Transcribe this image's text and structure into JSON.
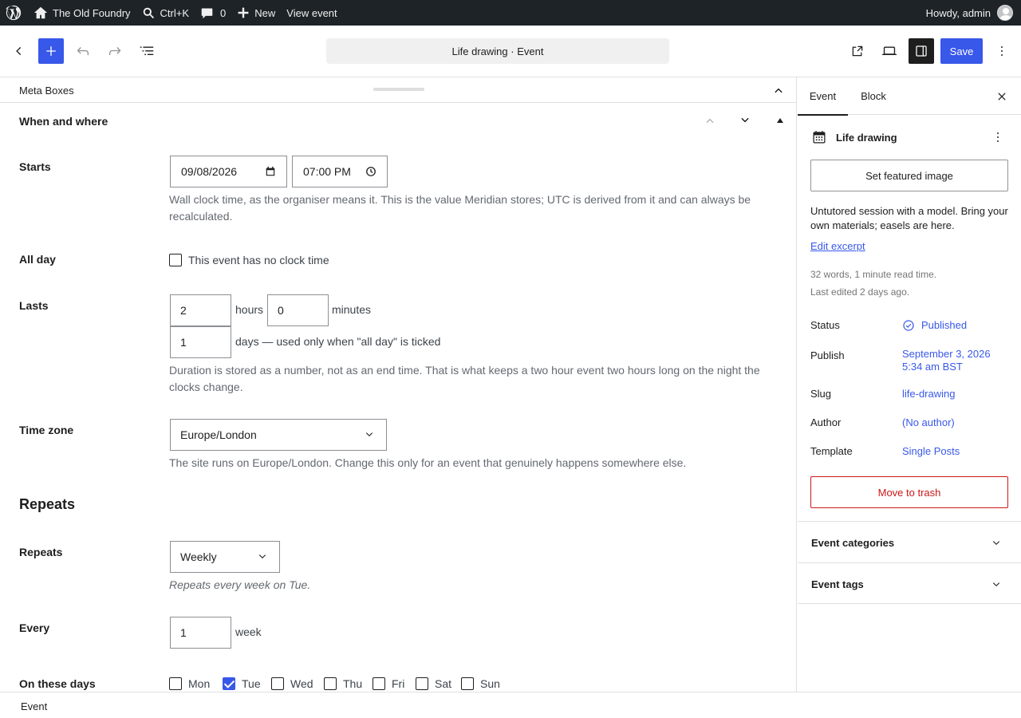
{
  "admin_bar": {
    "site_name": "The Old Foundry",
    "search_shortcut": "Ctrl+K",
    "comments_count": "0",
    "new_label": "New",
    "view_label": "View event",
    "howdy": "Howdy, admin"
  },
  "header": {
    "document_title": "Life drawing · Event",
    "save_label": "Save"
  },
  "meta_boxes": {
    "title": "Meta Boxes",
    "panel_title": "When and where"
  },
  "form": {
    "starts": {
      "label": "Starts",
      "date": "09/08/2026",
      "time": "07:00 PM",
      "help": "Wall clock time, as the organiser means it. This is the value Meridian stores; UTC is derived from it and can always be recalculated."
    },
    "all_day": {
      "label": "All day",
      "checkbox_label": "This event has no clock time",
      "checked": false
    },
    "lasts": {
      "label": "Lasts",
      "hours": "2",
      "hours_unit": "hours",
      "minutes": "0",
      "minutes_unit": "minutes",
      "days": "1",
      "days_unit": "days — used only when \"all day\" is ticked",
      "help": "Duration is stored as a number, not as an end time. That is what keeps a two hour event two hours long on the night the clocks change."
    },
    "time_zone": {
      "label": "Time zone",
      "value": "Europe/London",
      "help": "The site runs on Europe/London. Change this only for an event that genuinely happens somewhere else."
    },
    "repeats_heading": "Repeats",
    "repeats": {
      "label": "Repeats",
      "value": "Weekly",
      "help": "Repeats every week on Tue."
    },
    "every": {
      "label": "Every",
      "value": "1",
      "unit": "week"
    },
    "days": {
      "label": "On these days",
      "items": [
        {
          "label": "Mon",
          "checked": false
        },
        {
          "label": "Tue",
          "checked": true
        },
        {
          "label": "Wed",
          "checked": false
        },
        {
          "label": "Thu",
          "checked": false
        },
        {
          "label": "Fri",
          "checked": false
        },
        {
          "label": "Sat",
          "checked": false
        },
        {
          "label": "Sun",
          "checked": false
        }
      ]
    }
  },
  "footer": {
    "breadcrumb": "Event"
  },
  "sidebar": {
    "tabs": [
      "Event",
      "Block"
    ],
    "post_title": "Life drawing",
    "featured_image_label": "Set featured image",
    "excerpt": "Untutored session with a model. Bring your own materials; easels are here.",
    "edit_excerpt": "Edit excerpt",
    "word_count": "32 words, 1 minute read time.",
    "last_edited": "Last edited 2 days ago.",
    "rows": {
      "status": {
        "label": "Status",
        "value": "Published"
      },
      "publish": {
        "label": "Publish",
        "value_line1": "September 3, 2026",
        "value_line2": "5:34 am BST"
      },
      "slug": {
        "label": "Slug",
        "value": "life-drawing"
      },
      "author": {
        "label": "Author",
        "value": "(No author)"
      },
      "template": {
        "label": "Template",
        "value": "Single Posts"
      }
    },
    "trash_label": "Move to trash",
    "panels": [
      "Event categories",
      "Event tags"
    ]
  },
  "colors": {
    "accent": "#3858e9",
    "admin_bar": "#1d2327",
    "danger": "#cc1818"
  }
}
